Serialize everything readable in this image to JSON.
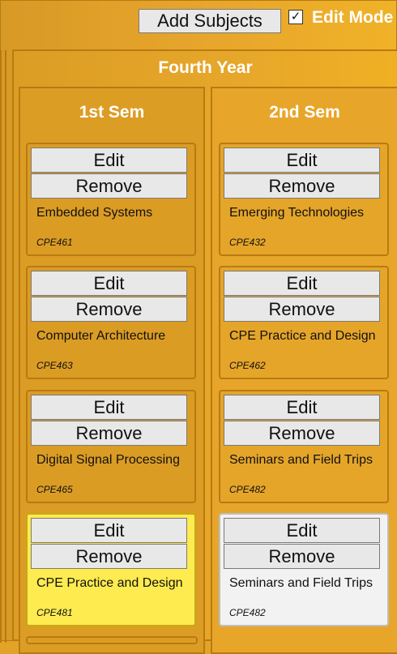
{
  "toolbar": {
    "add_subjects_label": "Add Subjects",
    "edit_mode_label": "Edit Mode",
    "edit_mode_checked": true,
    "checkmark": "✓"
  },
  "year": {
    "title": "Fourth Year",
    "semesters": [
      {
        "title": "1st Sem",
        "subjects": [
          {
            "name": "Embedded Systems",
            "code": "CPE461",
            "edit_label": "Edit",
            "remove_label": "Remove",
            "highlight": "none"
          },
          {
            "name": "Computer Architecture",
            "code": "CPE463",
            "edit_label": "Edit",
            "remove_label": "Remove",
            "highlight": "none"
          },
          {
            "name": "Digital Signal Processing",
            "code": "CPE465",
            "edit_label": "Edit",
            "remove_label": "Remove",
            "highlight": "none"
          },
          {
            "name": "CPE Practice and Design",
            "code": "CPE481",
            "edit_label": "Edit",
            "remove_label": "Remove",
            "highlight": "yellow"
          }
        ]
      },
      {
        "title": "2nd Sem",
        "subjects": [
          {
            "name": "Emerging Technologies",
            "code": "CPE432",
            "edit_label": "Edit",
            "remove_label": "Remove",
            "highlight": "none"
          },
          {
            "name": "CPE Practice and Design",
            "code": "CPE462",
            "edit_label": "Edit",
            "remove_label": "Remove",
            "highlight": "none"
          },
          {
            "name": "Seminars and Field Trips",
            "code": "CPE482",
            "edit_label": "Edit",
            "remove_label": "Remove",
            "highlight": "none"
          },
          {
            "name": "Seminars and Field Trips",
            "code": "CPE482",
            "edit_label": "Edit",
            "remove_label": "Remove",
            "highlight": "white"
          }
        ]
      }
    ]
  },
  "colors": {
    "background": "#e3a328",
    "panel_border": "#b97a12",
    "highlight_yellow": "#fdeb4f",
    "highlight_white": "#f2f2f2"
  }
}
